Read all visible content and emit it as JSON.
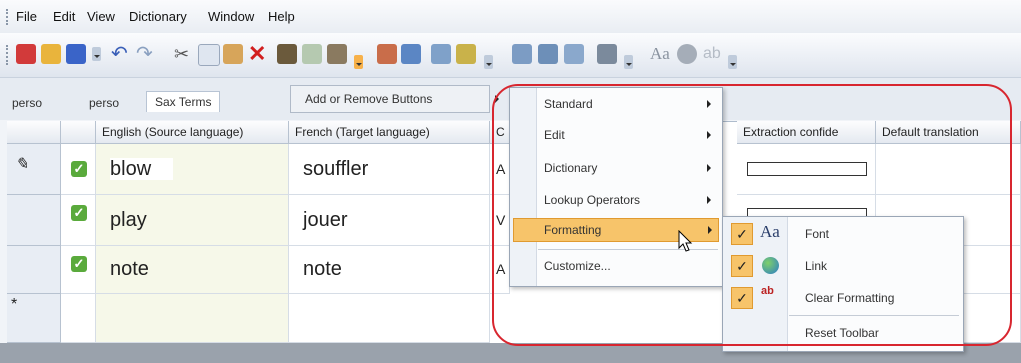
{
  "menubar": {
    "items": [
      "File",
      "Edit",
      "View",
      "Dictionary",
      "Window",
      "Help"
    ]
  },
  "toolbar": {
    "icons": [
      "new-icon",
      "open-icon",
      "save-icon",
      "undo-icon",
      "redo-icon",
      "cut-icon",
      "copy-icon",
      "paste-icon",
      "delete-icon",
      "find-icon",
      "find-replace-icon",
      "find-next-icon",
      "import-icon",
      "export-icon",
      "lookup-icon",
      "lookup-all-icon",
      "term-add-icon",
      "term-find-icon",
      "term-edit-icon",
      "merge-icon",
      "font-icon",
      "link-icon",
      "clear-formatting-icon"
    ]
  },
  "tabs": [
    "perso",
    "perso",
    "Sax Terms"
  ],
  "add_remove_button": "Add or Remove Buttons",
  "grid": {
    "columns": [
      "English (Source language)",
      "French (Target language)",
      "C",
      "Extraction confide",
      "Default translation"
    ],
    "rows": [
      {
        "source": "blow",
        "target": "souffler",
        "c": "A",
        "checked": true,
        "editing": true
      },
      {
        "source": "play",
        "target": "jouer",
        "c": "V",
        "checked": true,
        "editing": false
      },
      {
        "source": "note",
        "target": "note",
        "c": "A",
        "checked": true,
        "editing": false
      }
    ],
    "new_row_marker": "*",
    "edit_marker": "✎"
  },
  "menu": {
    "items": [
      {
        "label": "Standard",
        "submenu": true
      },
      {
        "label": "Edit",
        "submenu": true
      },
      {
        "label": "Dictionary",
        "submenu": true
      },
      {
        "label": "Lookup Operators",
        "submenu": true
      },
      {
        "label": "Formatting",
        "submenu": true,
        "highlighted": true
      },
      {
        "label": "Customize...",
        "submenu": false
      }
    ]
  },
  "submenu": {
    "items": [
      {
        "label": "Font",
        "checked": true,
        "icon": "font-icon"
      },
      {
        "label": "Link",
        "checked": true,
        "icon": "link-icon"
      },
      {
        "label": "Clear Formatting",
        "checked": true,
        "icon": "clear-formatting-icon"
      },
      {
        "label": "Reset Toolbar",
        "checked": false
      }
    ]
  },
  "check_glyph": "✓",
  "colors": {
    "highlight": "#f7c46a",
    "annotation": "#d8262f",
    "check_green": "#5aaa3c"
  }
}
